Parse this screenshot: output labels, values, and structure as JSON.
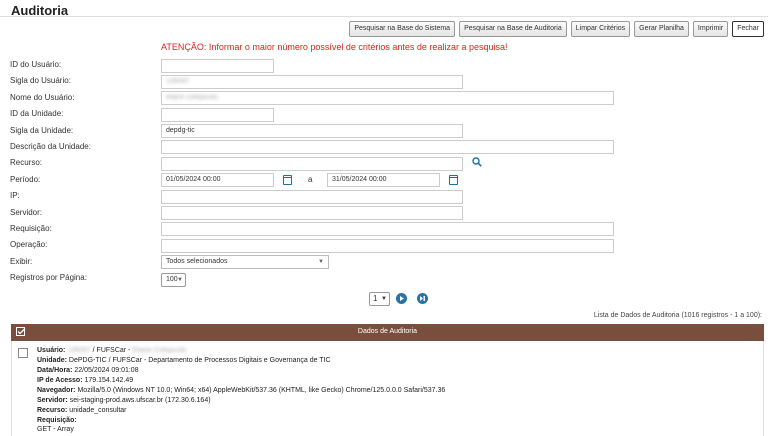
{
  "header": {
    "title": "Auditoria"
  },
  "toolbar": {
    "btn_sistema": "Pesquisar na Base do Sistema",
    "btn_auditoria": "Pesquisar na Base de Auditoria",
    "btn_limpar": "Limpar Critérios",
    "btn_planilha": "Gerar Planilha",
    "btn_imprimir": "Imprimir",
    "btn_fechar": "Fechar"
  },
  "warning": "ATENÇÃO: Informar o maior número possível de critérios antes de realizar a pesquisa!",
  "form": {
    "id_usuario": {
      "label": "ID do Usuário:",
      "value": ""
    },
    "sigla_usuario": {
      "label": "Sigla do Usuário:",
      "value": "135097"
    },
    "nome_usuario": {
      "label": "Nome do Usuário:",
      "value": "eliane colepicolo"
    },
    "id_unidade": {
      "label": "ID da Unidade:",
      "value": ""
    },
    "sigla_unidade": {
      "label": "Sigla da Unidade:",
      "value": "depdg-tic"
    },
    "descricao_unidade": {
      "label": "Descrição da Unidade:",
      "value": ""
    },
    "recurso": {
      "label": "Recurso:",
      "value": ""
    },
    "periodo": {
      "label": "Período:",
      "start": "01/05/2024 00:00",
      "separator": "a",
      "end": "31/05/2024 00:00"
    },
    "ip": {
      "label": "IP:",
      "value": ""
    },
    "servidor": {
      "label": "Servidor:",
      "value": ""
    },
    "requisicao": {
      "label": "Requisição:",
      "value": ""
    },
    "operacao": {
      "label": "Operação:",
      "value": ""
    },
    "exibir": {
      "label": "Exibir:",
      "value": "Todos selecionados"
    },
    "registros": {
      "label": "Registros por Página:",
      "value": "100"
    }
  },
  "pager": {
    "page": "1"
  },
  "list_caption": "Lista de Dados de Auditoria (1016 registros - 1 a 100):",
  "table": {
    "header": "Dados de Auditoria"
  },
  "record": {
    "usuario_label": "Usuário:",
    "usuario_sigla": "135097",
    "usuario_org": " / FUFSCar - ",
    "usuario_nome": "Eliane Colepicolo",
    "unidade_label": "Unidade:",
    "unidade_value": "DePDG-TIC / FUFSCar - Departamento de Processos Digitais e Governança de TIC",
    "data_label": "Data/Hora:",
    "data_value": "22/05/2024 09:01:08",
    "ip_label": "IP de Acesso:",
    "ip_value": "179.154.142.49",
    "nav_label": "Navegador:",
    "nav_value": "Mozilla/5.0 (Windows NT 10.0; Win64; x64) AppleWebKit/537.36 (KHTML, like Gecko) Chrome/125.0.0.0 Safari/537.36",
    "serv_label": "Servidor:",
    "serv_value": "sei-staging-prod.aws.ufscar.br (172.30.6.164)",
    "rec_label": "Recurso:",
    "rec_value": "unidade_consultar",
    "req_label": "Requisição:",
    "req_value": "GET - Array"
  },
  "colors": {
    "header_bg": "#7a4e3d",
    "warning": "#dd2222",
    "accent": "#1a6fa7"
  }
}
